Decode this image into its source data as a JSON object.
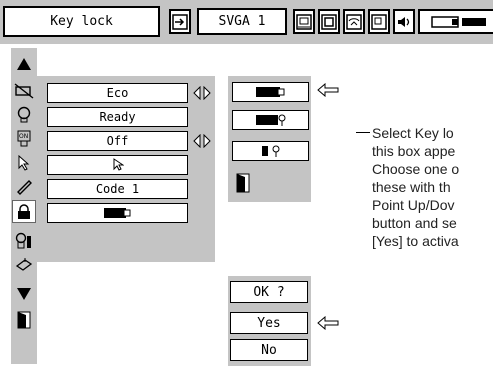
{
  "menu": {
    "title": "Key lock",
    "input_label": "SVGA 1"
  },
  "settings": {
    "eco": "Eco",
    "standby": "Ready",
    "power_on": "Off",
    "code": "Code 1"
  },
  "confirm": {
    "question": "OK ?",
    "yes": "Yes",
    "no": "No"
  },
  "callout": "Select Key lo\nthis box appe\nChoose one o\nthese with th\nPoint Up/Dov\nbutton and se\n[Yes] to activa",
  "icons": {
    "menu_bar": [
      "input-icon",
      "screen-icon",
      "picture-icon",
      "image-icon",
      "settings-icon",
      "sound-icon",
      "projector-icon"
    ],
    "sidebar": [
      "up-arrow-icon",
      "lamp-off-icon",
      "lamp-icon",
      "power-on-icon",
      "pointer-icon",
      "remote-icon",
      "lock-icon",
      "keypad-lock-icon",
      "filter-icon",
      "down-arrow-icon",
      "exit-door-icon"
    ]
  },
  "colors": {
    "panel": "#c4c4c4",
    "box": "#ffffff"
  }
}
